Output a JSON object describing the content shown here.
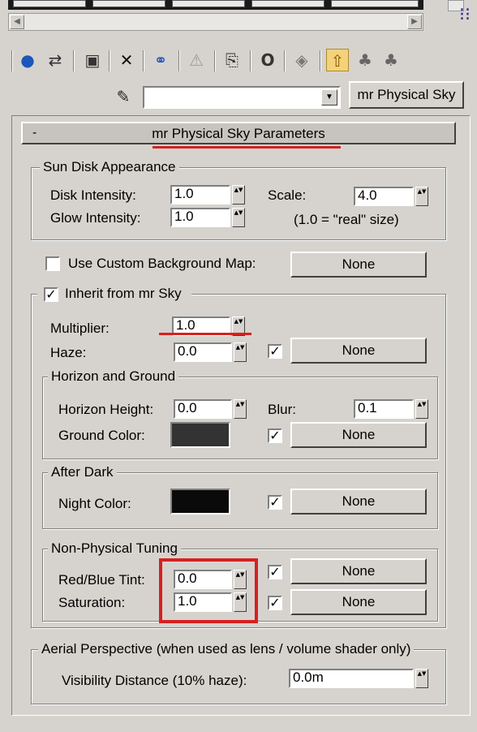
{
  "colors": {
    "accent_highlight": "#d72020",
    "panel_bg": "#d6d3ce",
    "ground_color": "#333333",
    "night_color": "#0a0a0a"
  },
  "toolbar": {
    "icons": [
      "get-material-icon",
      "put-to-scene-icon",
      "assign-material-icon",
      "reset-icon",
      "copy-material-icon",
      "make-unique-icon",
      "put-to-library-icon",
      "material-id-icon",
      "show-map-icon",
      "show-end-result-icon",
      "go-to-parent-icon",
      "go-forward-icon",
      "options-icon"
    ]
  },
  "name_row": {
    "name_value": "",
    "type_button": "mr Physical Sky"
  },
  "rollout": {
    "minus": "-",
    "title": "mr Physical Sky Parameters"
  },
  "sun_disk": {
    "legend": "Sun Disk Appearance",
    "disk_intensity_label": "Disk Intensity:",
    "disk_intensity": "1.0",
    "glow_intensity_label": "Glow Intensity:",
    "glow_intensity": "1.0",
    "scale_label": "Scale:",
    "scale": "4.0",
    "scale_note": "(1.0 = \"real\" size)"
  },
  "background": {
    "label": "Use Custom Background Map:",
    "checked": false,
    "button": "None"
  },
  "inherit": {
    "label": "Inherit from mr Sky",
    "checked": true,
    "check_mark": "✓",
    "multiplier_label": "Multiplier:",
    "multiplier": "1.0",
    "haze_label": "Haze:",
    "haze": "0.0",
    "haze_button": "None"
  },
  "horizon": {
    "legend": "Horizon and Ground",
    "height_label": "Horizon Height:",
    "height": "0.0",
    "blur_label": "Blur:",
    "blur": "0.1",
    "ground_label": "Ground Color:",
    "ground_button": "None"
  },
  "after_dark": {
    "legend": "After Dark",
    "night_label": "Night Color:",
    "night_button": "None"
  },
  "non_physical": {
    "legend": "Non-Physical Tuning",
    "tint_label": "Red/Blue Tint:",
    "tint": "0.0",
    "tint_button": "None",
    "saturation_label": "Saturation:",
    "saturation": "1.0",
    "saturation_button": "None"
  },
  "aerial": {
    "legend": "Aerial Perspective (when used as lens / volume shader only)",
    "distance_label": "Visibility Distance (10% haze):",
    "distance": "0.0m"
  },
  "glyphs": {
    "spin": "▲▼",
    "dropdown": "▼",
    "scroll_left": "◀",
    "scroll_right": "▶",
    "check": "✓"
  }
}
